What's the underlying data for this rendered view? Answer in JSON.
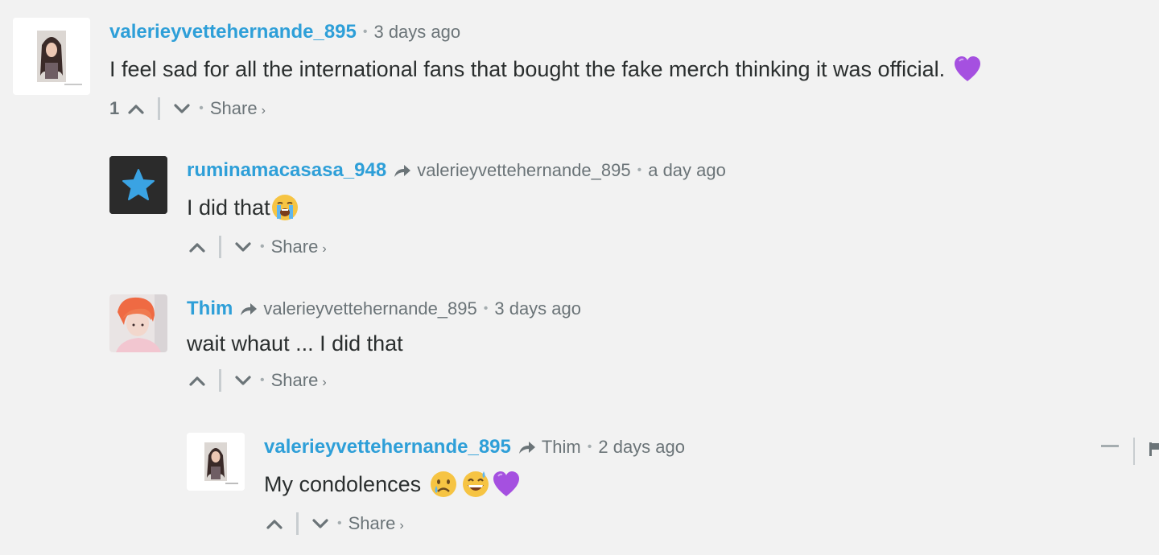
{
  "colors": {
    "background": "#f2f2f2",
    "author_link": "#2e9fd8",
    "meta_text": "#6b7478",
    "body_text": "#2a2e2e"
  },
  "comments": [
    {
      "author": "valerieyvettehernande_895",
      "parent": "",
      "timestamp": "3 days ago",
      "text": "I feel sad for all the international fans that bought the fake merch thinking it was official.",
      "emojis": [
        "purple-heart"
      ],
      "votes": "1",
      "share_label": "Share",
      "share_chevron": "›"
    },
    {
      "author": "ruminamacasasa_948",
      "parent": "valerieyvettehernande_895",
      "timestamp": "a day ago",
      "text": "I did that",
      "emojis": [
        "loudly-crying-face"
      ],
      "votes": "",
      "share_label": "Share",
      "share_chevron": "›"
    },
    {
      "author": "Thim",
      "parent": "valerieyvettehernande_895",
      "timestamp": "3 days ago",
      "text": "wait whaut ... I did that",
      "emojis": [],
      "votes": "",
      "share_label": "Share",
      "share_chevron": "›"
    },
    {
      "author": "valerieyvettehernande_895",
      "parent": "Thim",
      "timestamp": "2 days ago",
      "text": "My condolences",
      "emojis": [
        "crying-face",
        "grinning-sweat-face",
        "purple-heart"
      ],
      "votes": "",
      "share_label": "Share",
      "share_chevron": "›"
    }
  ],
  "separator_bullet": "•",
  "icons": {
    "upvote": "chevron-up-icon",
    "downvote": "chevron-down-icon",
    "reply": "reply-arrow-icon",
    "collapse": "minus-icon",
    "flag": "flag-icon",
    "star_avatar": "star-icon"
  }
}
